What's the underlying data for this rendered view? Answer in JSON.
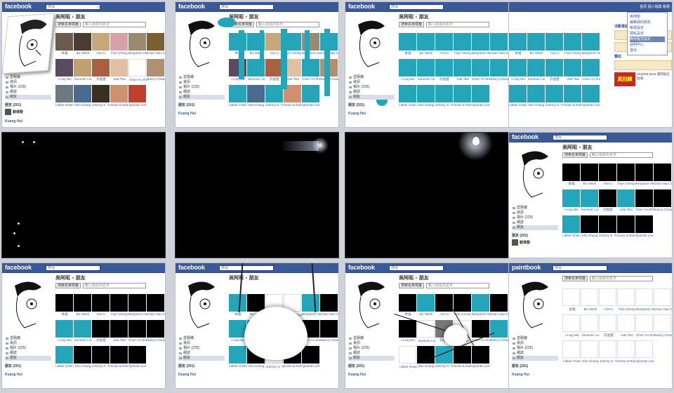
{
  "app": {
    "logo": "facebook",
    "logo_alt": "paintbook",
    "search_placeholder": "搜尋",
    "page_title": "吳阿昭 › 朋友",
    "nav_right": "首頁   個人檔案   帳號"
  },
  "toolbar": {
    "filter_label": "搜索名單標籤",
    "search_placeholder": "輸入朋友的名字"
  },
  "sidebar": {
    "items": [
      {
        "label": "塗鴉牆"
      },
      {
        "label": "資訊"
      },
      {
        "label": "相片 (225)"
      },
      {
        "label": "網誌"
      },
      {
        "label": "朋友"
      }
    ],
    "friends_count": "朋友 (201)",
    "friend_link_1": "劉偉聖",
    "friend_link_2": "Kuang Hui"
  },
  "friends": [
    [
      "本嵐",
      "Bo Hsieh",
      "Arie Li",
      "Fiye Cheng",
      "Benjamin Hsu",
      "Chan-Hau Chen"
    ],
    [
      "I-Ling Wu",
      "Summer Liu",
      "許益當",
      "Ada Tsai",
      "Chun-Yu Shih",
      "Nancy Chang"
    ],
    [
      "Libbie Chien",
      "Sho Chang",
      "Johnny S. Tu",
      "Snow & Rain",
      "Quentin Lee"
    ]
  ],
  "dropdown": {
    "items": [
      "吳阿昭",
      "編輯我的朋友",
      "帳號設定",
      "隱私設定",
      "應用程式設定",
      "說明中心",
      "登出"
    ]
  },
  "right_column": {
    "events_heading": "活動邀請",
    "ads_heading": "贊助",
    "ad_badge": "真回饋",
    "ad_text": "2010/05-2011 第四屆全台灣..."
  },
  "colors": {
    "fb_blue": "#3b5998",
    "teal_paint": "#25a5b9",
    "sidebar_selected": "#d8dfea"
  }
}
